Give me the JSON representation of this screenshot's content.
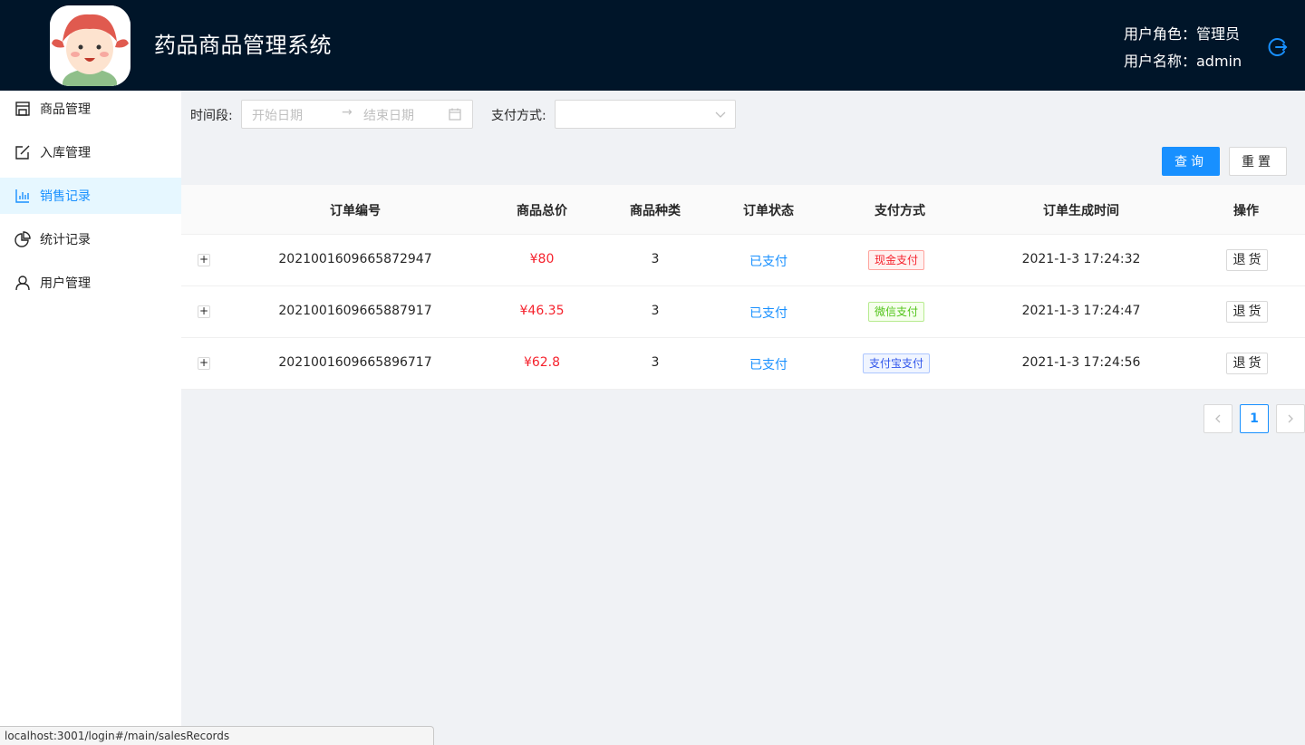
{
  "header": {
    "title": "药品商品管理系统",
    "user_role": "用户角色：管理员",
    "user_name": "用户名称：admin"
  },
  "sidebar": {
    "items": [
      {
        "label": "商品管理",
        "icon": "shop-icon"
      },
      {
        "label": "入库管理",
        "icon": "edit-icon"
      },
      {
        "label": "销售记录",
        "icon": "bar-chart-icon",
        "active": true
      },
      {
        "label": "统计记录",
        "icon": "pie-chart-icon"
      },
      {
        "label": "用户管理",
        "icon": "user-icon"
      }
    ]
  },
  "filters": {
    "period_label": "时间段:",
    "start_placeholder": "开始日期",
    "end_placeholder": "结束日期",
    "payment_label": "支付方式:",
    "payment_value": "",
    "query_button": "查询",
    "reset_button": "重置"
  },
  "table": {
    "columns": [
      "订单编号",
      "商品总价",
      "商品种类",
      "订单状态",
      "支付方式",
      "订单生成时间",
      "操作"
    ],
    "rows": [
      {
        "order_no": "2021001609665872947",
        "total": "¥80",
        "kinds": "3",
        "status": "已支付",
        "payment": "现金支付",
        "payment_color": "red",
        "time": "2021-1-3 17:24:32",
        "action": "退货"
      },
      {
        "order_no": "2021001609665887917",
        "total": "¥46.35",
        "kinds": "3",
        "status": "已支付",
        "payment": "微信支付",
        "payment_color": "green",
        "time": "2021-1-3 17:24:47",
        "action": "退货"
      },
      {
        "order_no": "2021001609665896717",
        "total": "¥62.8",
        "kinds": "3",
        "status": "已支付",
        "payment": "支付宝支付",
        "payment_color": "blue",
        "time": "2021-1-3 17:24:56",
        "action": "退货"
      }
    ]
  },
  "pagination": {
    "current": "1"
  },
  "status_bar": {
    "url": "localhost:3001/login#/main/salesRecords"
  },
  "colors": {
    "header_bg": "#001529",
    "primary": "#1890ff",
    "price": "#f5222d"
  }
}
